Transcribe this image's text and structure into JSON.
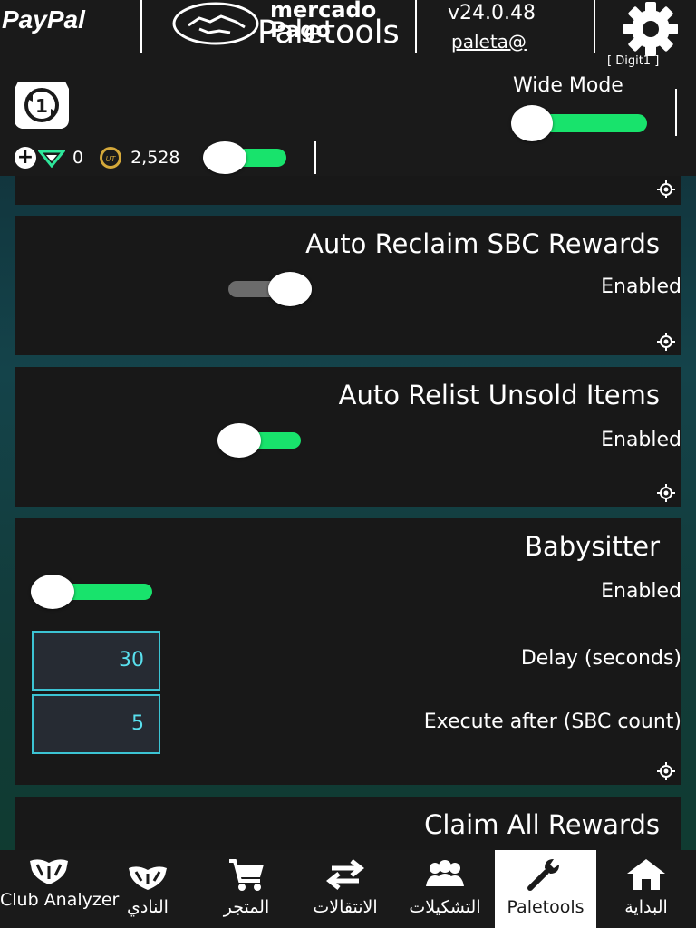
{
  "topbar": {
    "paypal": "PayPal",
    "mercado_line1": "mercado",
    "mercado_line2": "Pago",
    "app_title": "Paletools",
    "version": "v24.0.48",
    "user": "paleta@",
    "settings_label": "[ Digit1 ]"
  },
  "header": {
    "badge_number": "1",
    "wide_mode_label": "Wide Mode",
    "wide_mode_on": true,
    "points": "0",
    "coins": "2,528",
    "coin_label": "UT"
  },
  "cards": [
    {
      "title": "Auto Reclaim SBC Rewards",
      "status": "Enabled",
      "toggle_on": false
    },
    {
      "title": "Auto Relist Unsold Items",
      "status": "Enabled",
      "toggle_on": true
    },
    {
      "title": "Babysitter",
      "status": "Enabled",
      "toggle_on": true,
      "fields": [
        {
          "label": "Delay (seconds)",
          "value": "30"
        },
        {
          "label": "Execute after (SBC count)",
          "value": "5"
        }
      ]
    },
    {
      "title": "Claim All Rewards"
    }
  ],
  "nav": [
    {
      "label": "Club Analyzer",
      "icon": "shield-icon"
    },
    {
      "label": "النادي",
      "icon": "shield-icon"
    },
    {
      "label": "المتجر",
      "icon": "cart-icon"
    },
    {
      "label": "الانتقالات",
      "icon": "transfer-arrows-icon"
    },
    {
      "label": "التشكيلات",
      "icon": "squad-icon"
    },
    {
      "label": "Paletools",
      "icon": "wrench-icon",
      "active": true
    },
    {
      "label": "البداية",
      "icon": "home-icon"
    }
  ],
  "colors": {
    "toggle_on": "#18e36c",
    "toggle_off": "#6b6b6b",
    "panel": "#181818",
    "accent_cyan": "#3cc4d4"
  }
}
